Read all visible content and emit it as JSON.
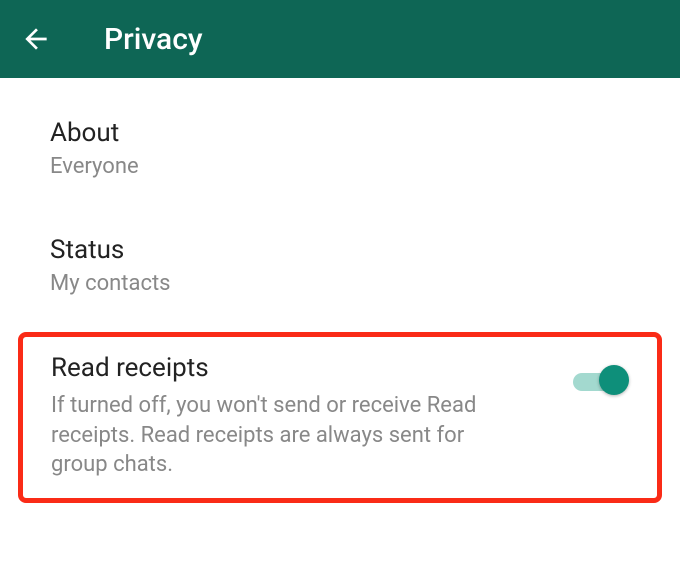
{
  "header": {
    "title": "Privacy"
  },
  "settings": {
    "about": {
      "title": "About",
      "value": "Everyone"
    },
    "status": {
      "title": "Status",
      "value": "My contacts"
    },
    "readReceipts": {
      "title": "Read receipts",
      "description": "If turned off, you won't send or receive Read receipts. Read receipts are always sent for group chats.",
      "enabled": true
    }
  },
  "colors": {
    "headerBg": "#0e6655",
    "toggleTrack": "#a3d9cf",
    "toggleThumb": "#0e8f7a",
    "highlightBorder": "#fa2b17"
  }
}
